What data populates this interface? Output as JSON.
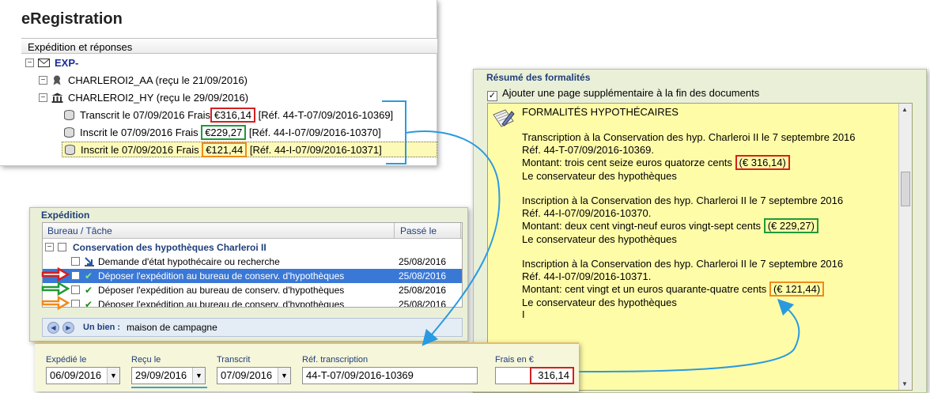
{
  "app": {
    "title": "eRegistration",
    "tree_header": "Expédition et réponses",
    "tree": {
      "root_label": "EXP-",
      "nodes": [
        {
          "label": "CHARLEROI2_AA (reçu le 21/09/2016)",
          "icon": "award-ribbon-icon"
        },
        {
          "label": "CHARLEROI2_HY (reçu le 29/09/2016)",
          "icon": "bank-building-icon"
        }
      ],
      "leaves": [
        {
          "prefix": "Transcrit le 07/09/2016 Frais",
          "amount": "€316,14",
          "ref": "[Réf. 44-T-07/09/2016-10369]"
        },
        {
          "prefix": "Inscrit le 07/09/2016 Frais",
          "amount": "€229,27",
          "ref": "[Réf. 44-I-07/09/2016-10370]"
        },
        {
          "prefix": "Inscrit le 07/09/2016 Frais",
          "amount": "€121,44",
          "ref": "[Réf. 44-I-07/09/2016-10371]"
        }
      ]
    }
  },
  "resume": {
    "group_title": "Résumé des formalités",
    "checkbox_label": "Ajouter une page supplémentaire à la fin des documents",
    "checkbox_checked": "✓",
    "heading": "FORMALITÉS HYPOTHÉCAIRES",
    "entries": [
      {
        "line1": "Transcription à la Conservation des hyp. Charleroi II le 7 septembre 2016",
        "line2": "Réf. 44-T-07/09/2016-10369.",
        "amount_text": "Montant: trois cent seize euros quatorze cents",
        "amount": "(€ 316,14)",
        "signature": "Le conservateur des hypothèques"
      },
      {
        "line1": "Inscription à la Conservation des hyp. Charleroi II le 7 septembre 2016",
        "line2": "Réf. 44-I-07/09/2016-10370.",
        "amount_text": "Montant: deux cent vingt-neuf euros vingt-sept cents",
        "amount": "(€ 229,27)",
        "signature": "Le conservateur des hypothèques"
      },
      {
        "line1": "Inscription à la Conservation des hyp. Charleroi II le 7 septembre 2016",
        "line2": "Réf. 44-I-07/09/2016-10371.",
        "amount_text": "Montant: cent vingt et un euros quarante-quatre cents",
        "amount": "(€ 121,44)",
        "signature": "Le conservateur des hypothèques"
      }
    ],
    "cursor": "I"
  },
  "expedition": {
    "group_title": "Expédition",
    "columns": {
      "task": "Bureau / Tâche",
      "date": "Passé le"
    },
    "group_row": "Conservation des hypothèques Charleroi II",
    "rows": [
      {
        "label": "Demande d'état hypothécaire ou recherche",
        "date": "25/08/2016",
        "extra": "V"
      },
      {
        "label": "Déposer l'expédition au bureau de conserv. d'hypothèques",
        "date": "25/08/2016",
        "extra": "V"
      },
      {
        "label": "Déposer l'expédition au bureau de conserv. d'hypothèques",
        "date": "25/08/2016",
        "extra": "V"
      },
      {
        "label": "Déposer l'expédition au bureau de conserv. d'hypothèques",
        "date": "25/08/2016",
        "extra": "V"
      }
    ],
    "bien_label": "Un bien :",
    "bien_value": "maison de campagne"
  },
  "form": {
    "expedie_label": "Expédié le",
    "expedie_value": "06/09/2016",
    "recu_label": "Reçu le",
    "recu_value": "29/09/2016",
    "transcrit_label": "Transcrit",
    "transcrit_value": "07/09/2016",
    "ref_label": "Réf. transcription",
    "ref_value": "44-T-07/09/2016-10369",
    "frais_label": "Frais en €",
    "frais_value": "316,14"
  },
  "colors": {
    "red": "#d42020",
    "green": "#1f9a38",
    "orange": "#f08a1c",
    "blue": "#2a9ae0",
    "selection": "#3a78d6"
  }
}
